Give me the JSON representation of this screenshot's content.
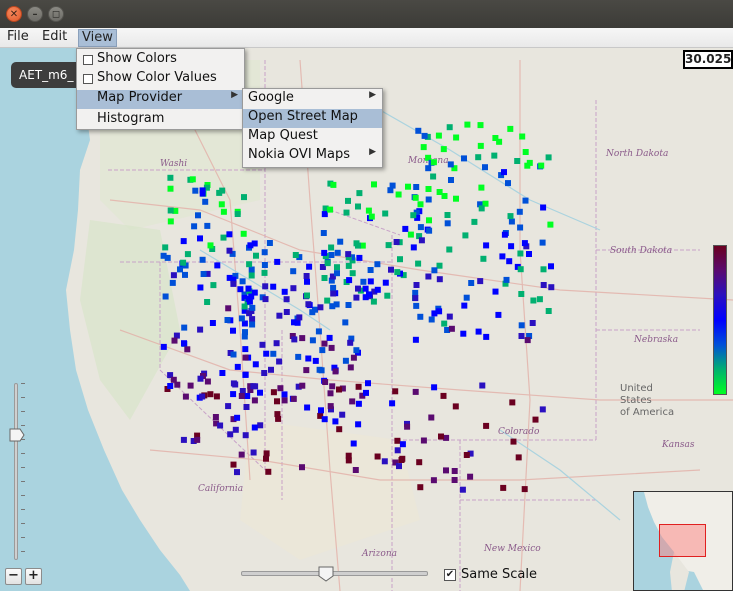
{
  "window": {
    "close_glyph": "✕",
    "min_glyph": "–",
    "max_glyph": "◻"
  },
  "menubar": {
    "file": "File",
    "edit": "Edit",
    "view": "View"
  },
  "view_menu": {
    "items": [
      {
        "label": "Show Colors",
        "type": "checkbox",
        "checked": false
      },
      {
        "label": "Show Color Values",
        "type": "checkbox",
        "checked": false
      },
      {
        "label": "Map Provider",
        "type": "submenu",
        "highlighted": true
      },
      {
        "label": "Histogram",
        "type": "item"
      }
    ]
  },
  "provider_menu": {
    "items": [
      {
        "label": "Google",
        "submenu": true
      },
      {
        "label": "Open Street Map",
        "highlighted": true
      },
      {
        "label": "Map Quest"
      },
      {
        "label": "Nokia OVI Maps",
        "submenu": true
      }
    ]
  },
  "tab": {
    "label": "AET_m6_"
  },
  "value_display": "30.025",
  "map_labels": {
    "washington": "Washi",
    "montana": "Montana",
    "north_dakota": "North Dakota",
    "south_dakota": "South Dakota",
    "nebraska": "Nebraska",
    "united_states_1": "United",
    "united_states_2": "States",
    "united_states_3": "of America",
    "kansas": "Kansas",
    "colorado": "Colorado",
    "california": "California",
    "arizona": "Arizona",
    "new_mexico": "New Mexico"
  },
  "controls": {
    "zoom_out": "−",
    "zoom_in": "+",
    "same_scale_label": "Same Scale",
    "same_scale_checked": true,
    "checkbox_glyph": "✔"
  },
  "legend_colors": [
    "#6a0020",
    "#5a0a70",
    "#2a10c0",
    "#0000ff",
    "#0050d8",
    "#00b070",
    "#00ff22"
  ]
}
